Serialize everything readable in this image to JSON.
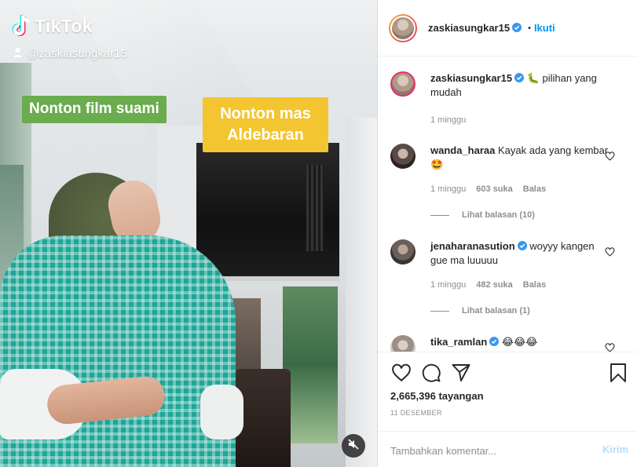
{
  "video": {
    "brand": "TikTok",
    "tiktok_username": "@zaskiasungkar15",
    "caption_left": "Nonton film suami",
    "caption_right": "Nonton mas Aldebaran",
    "icons": {
      "logo": "tiktok-note-icon",
      "user": "user-icon",
      "mute": "speaker-muted-icon"
    }
  },
  "header": {
    "username": "zaskiasungkar15",
    "separator": "•",
    "follow_label": "Ikuti"
  },
  "caption": {
    "username": "zaskiasungkar15",
    "text": "🐛 pilihan yang mudah",
    "time": "1 minggu"
  },
  "comments": [
    {
      "username": "wanda_haraa",
      "text": "Kayak ada yang kembar 🤩",
      "time": "1 minggu",
      "likes": "603 suka",
      "reply_label": "Balas",
      "view_replies": "Lihat balasan (10)"
    },
    {
      "username": "jenaharanasution",
      "text": "woyyy kangen gue ma luuuuu",
      "time": "1 minggu",
      "likes": "482 suka",
      "reply_label": "Balas",
      "view_replies": "Lihat balasan (1)"
    },
    {
      "username": "tika_ramlan",
      "text": "😂😂😂"
    }
  ],
  "actions": {
    "views": "2,665,396 tayangan",
    "date": "11 DESEMBER",
    "comment_placeholder": "Tambahkan komentar...",
    "post_label": "Kirim",
    "icons": [
      "heart-icon",
      "comment-icon",
      "share-icon",
      "bookmark-icon"
    ]
  },
  "colors": {
    "accent": "#0095f6",
    "post_disabled": "#b2dffc",
    "muted_text": "#8e8e8e",
    "label_green": "#6aac4e",
    "label_yellow": "#f3c531"
  }
}
